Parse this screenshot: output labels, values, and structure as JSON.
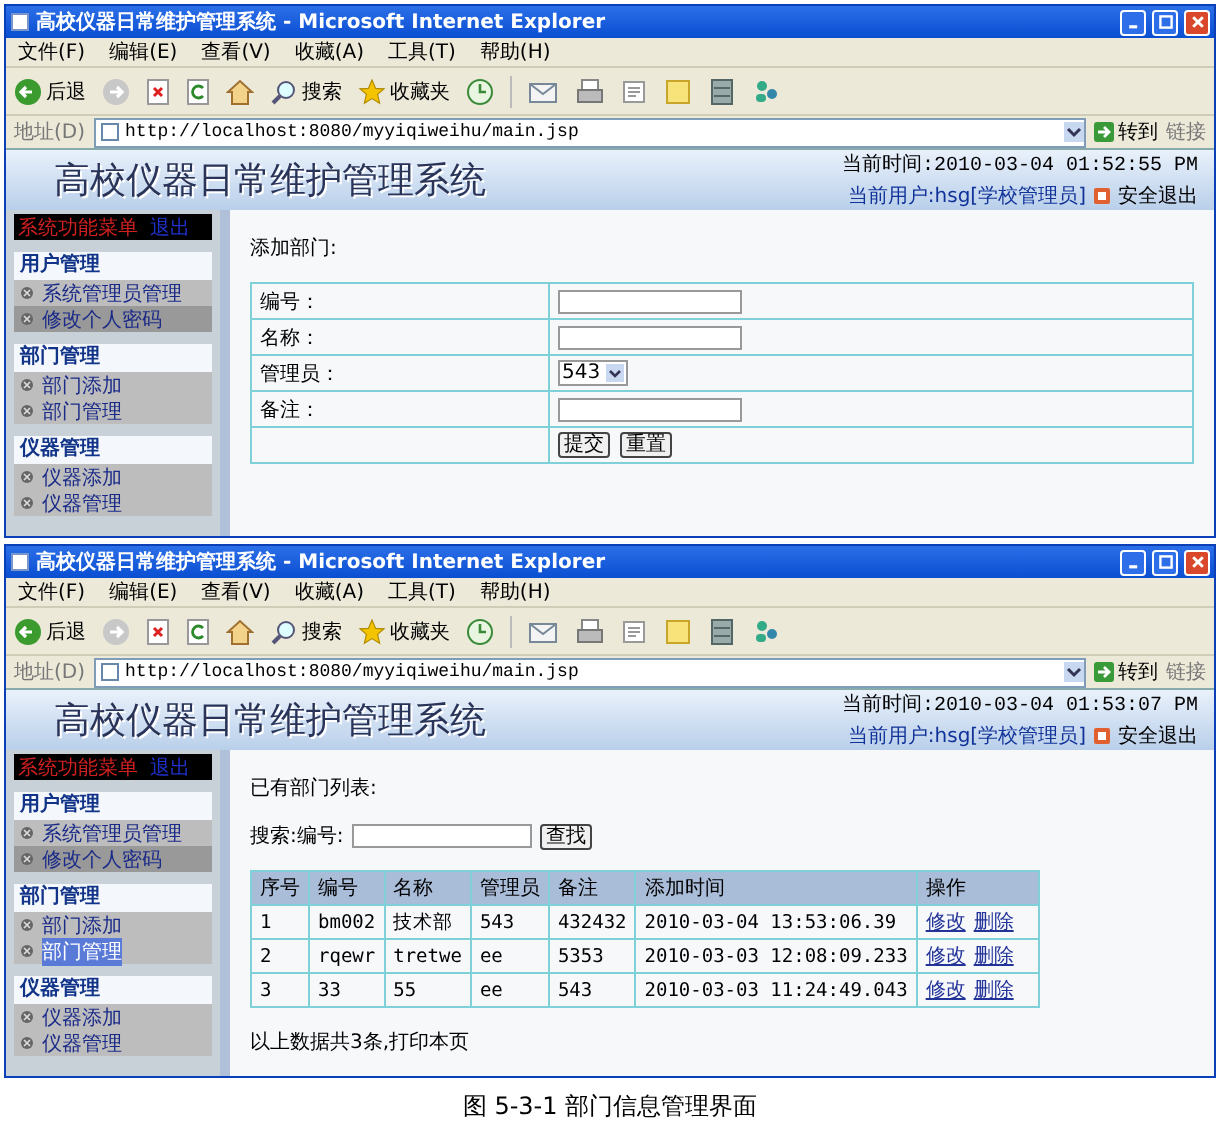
{
  "windows": [
    {
      "title": "高校仪器日常维护管理系统 - Microsoft Internet Explorer",
      "menu": [
        "文件(F)",
        "编辑(E)",
        "查看(V)",
        "收藏(A)",
        "工具(T)",
        "帮助(H)"
      ],
      "toolbar": {
        "back": "后退",
        "search": "搜索",
        "favorites": "收藏夹"
      },
      "address": {
        "label": "地址(D)",
        "url": "http://localhost:8080/myyiqiweihu/main.jsp",
        "go": "转到",
        "links": "链接"
      },
      "app": {
        "title": "高校仪器日常维护管理系统",
        "time": "当前时间:2010-03-04 01:52:55 PM",
        "user": "当前用户:hsg[学校管理员]",
        "logout": "安全退出"
      },
      "menu_header": {
        "title": "系统功能菜单",
        "link": "退出"
      },
      "sidebar": [
        {
          "heading": "用户管理",
          "items": [
            {
              "label": "系统管理员管理",
              "selected": false,
              "highlighted": false
            },
            {
              "label": "修改个人密码",
              "selected": true,
              "highlighted": false
            }
          ]
        },
        {
          "heading": "部门管理",
          "items": [
            {
              "label": "部门添加",
              "selected": false,
              "highlighted": false
            },
            {
              "label": "部门管理",
              "selected": false,
              "highlighted": false
            }
          ]
        },
        {
          "heading": "仪器管理",
          "items": [
            {
              "label": "仪器添加",
              "selected": false,
              "highlighted": false
            },
            {
              "label": "仪器管理",
              "selected": false,
              "highlighted": false
            }
          ]
        }
      ],
      "content": {
        "kind": "form",
        "heading": "添加部门:",
        "fields": [
          {
            "label": "编号：",
            "kind": "text"
          },
          {
            "label": "名称：",
            "kind": "text"
          },
          {
            "label": "管理员：",
            "kind": "select",
            "value": "543"
          },
          {
            "label": "备注：",
            "kind": "text"
          }
        ],
        "buttons": [
          "提交",
          "重置"
        ]
      }
    },
    {
      "title": "高校仪器日常维护管理系统 - Microsoft Internet Explorer",
      "menu": [
        "文件(F)",
        "编辑(E)",
        "查看(V)",
        "收藏(A)",
        "工具(T)",
        "帮助(H)"
      ],
      "toolbar": {
        "back": "后退",
        "search": "搜索",
        "favorites": "收藏夹"
      },
      "address": {
        "label": "地址(D)",
        "url": "http://localhost:8080/myyiqiweihu/main.jsp",
        "go": "转到",
        "links": "链接"
      },
      "app": {
        "title": "高校仪器日常维护管理系统",
        "time": "当前时间:2010-03-04 01:53:07 PM",
        "user": "当前用户:hsg[学校管理员]",
        "logout": "安全退出"
      },
      "menu_header": {
        "title": "系统功能菜单",
        "link": "退出"
      },
      "sidebar": [
        {
          "heading": "用户管理",
          "items": [
            {
              "label": "系统管理员管理",
              "selected": false,
              "highlighted": false
            },
            {
              "label": "修改个人密码",
              "selected": true,
              "highlighted": false
            }
          ]
        },
        {
          "heading": "部门管理",
          "items": [
            {
              "label": "部门添加",
              "selected": false,
              "highlighted": false
            },
            {
              "label": "部门管理",
              "selected": false,
              "highlighted": true
            }
          ]
        },
        {
          "heading": "仪器管理",
          "items": [
            {
              "label": "仪器添加",
              "selected": false,
              "highlighted": false
            },
            {
              "label": "仪器管理",
              "selected": false,
              "highlighted": false
            }
          ]
        }
      ],
      "content": {
        "kind": "list",
        "heading": "已有部门列表:",
        "search": {
          "label": "搜索:编号:",
          "button": "查找"
        },
        "table": {
          "columns": [
            "序号",
            "编号",
            "名称",
            "管理员",
            "备注",
            "添加时间",
            "操作"
          ],
          "rows": [
            {
              "cells": [
                "1",
                "bm002",
                "技术部",
                "543",
                "432432",
                "2010-03-04 13:53:06.39"
              ],
              "actions": [
                "修改",
                "删除"
              ]
            },
            {
              "cells": [
                "2",
                "rqewr",
                "tretwe",
                "ee",
                "5353",
                "2010-03-03 12:08:09.233"
              ],
              "actions": [
                "修改",
                "删除"
              ]
            },
            {
              "cells": [
                "3",
                "33",
                "55",
                "ee",
                "543",
                "2010-03-03 11:24:49.043"
              ],
              "actions": [
                "修改",
                "删除"
              ]
            }
          ]
        },
        "footer": "以上数据共3条,打印本页"
      }
    }
  ],
  "caption": "图 5-3-1 部门信息管理界面"
}
